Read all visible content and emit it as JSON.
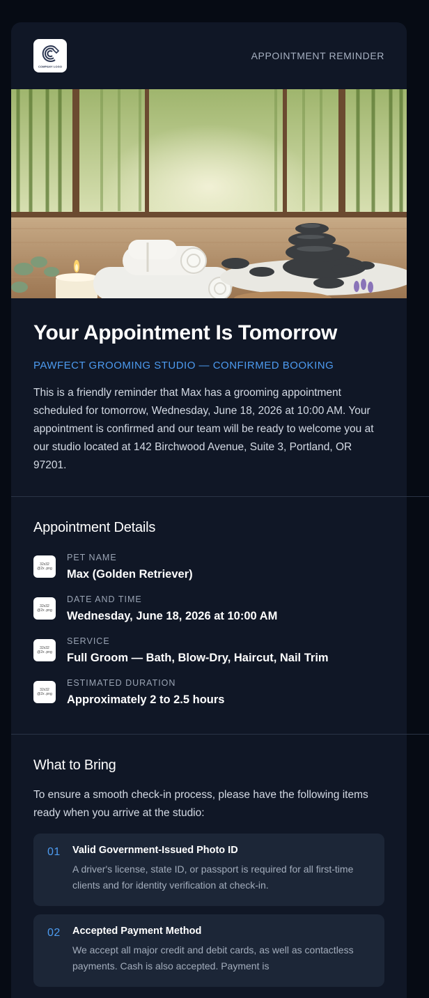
{
  "header": {
    "logo_text": "COMPANY LOGO",
    "label": "APPOINTMENT REMINDER"
  },
  "hero": {
    "icon": "spa-scene-image"
  },
  "intro": {
    "title": "Your Appointment Is Tomorrow",
    "subtitle": "PAWFECT GROOMING STUDIO — CONFIRMED BOOKING",
    "body": "This is a friendly reminder that Max has a grooming appointment scheduled for tomorrow, Wednesday, June 18, 2026 at 10:00 AM. Your appointment is confirmed and our team will be ready to welcome you at our studio located at 142 Birchwood Avenue, Suite 3, Portland, OR 97201."
  },
  "details": {
    "title": "Appointment Details",
    "icon_placeholder_line1": "32x32",
    "icon_placeholder_line2": "@2x .png",
    "items": [
      {
        "label": "PET NAME",
        "value": "Max (Golden Retriever)"
      },
      {
        "label": "DATE AND TIME",
        "value": "Wednesday, June 18, 2026 at 10:00 AM"
      },
      {
        "label": "SERVICE",
        "value": "Full Groom — Bath, Blow-Dry, Haircut, Nail Trim"
      },
      {
        "label": "ESTIMATED DURATION",
        "value": "Approximately 2 to 2.5 hours"
      }
    ]
  },
  "bring": {
    "title": "What to Bring",
    "intro": "To ensure a smooth check-in process, please have the following items ready when you arrive at the studio:",
    "items": [
      {
        "num": "01",
        "title": "Valid Government-Issued Photo ID",
        "desc": "A driver's license, state ID, or passport is required for all first-time clients and for identity verification at check-in."
      },
      {
        "num": "02",
        "title": "Accepted Payment Method",
        "desc": "We accept all major credit and debit cards, as well as contactless payments. Cash is also accepted. Payment is"
      }
    ]
  },
  "colors": {
    "background": "#060b14",
    "card": "#101726",
    "accent": "#4d9bf0",
    "item_bg": "#1c2637"
  }
}
